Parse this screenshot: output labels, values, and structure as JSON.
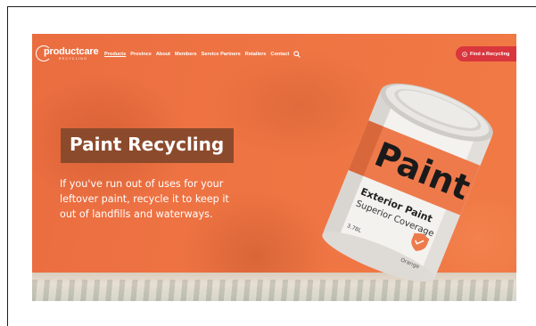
{
  "site": {
    "logo": {
      "main": "productcare",
      "sub": "RECYCLING"
    },
    "nav": {
      "items": [
        {
          "label": "Products",
          "active": true
        },
        {
          "label": "Province",
          "active": false
        },
        {
          "label": "About",
          "active": false
        },
        {
          "label": "Members",
          "active": false
        },
        {
          "label": "Service Partners",
          "active": false
        },
        {
          "label": "Retailers",
          "active": false
        },
        {
          "label": "Contact",
          "active": false
        }
      ],
      "search_icon": "search-icon"
    },
    "cta": {
      "label": "Find a Recycling",
      "icon": "location-pin-icon"
    },
    "hero": {
      "title": "Paint Recycling",
      "subtitle": "If you've run out of uses for your leftover paint, recycle it to keep it out of landfills and waterways."
    },
    "paint_can": {
      "label_big": "Paint",
      "label_line1": "Exterior Paint",
      "label_line2": "Superior Coverage",
      "volume": "3.78L",
      "color_name": "Orange"
    }
  },
  "colors": {
    "hero_orange": "#ef7443",
    "title_box": "#8c4a2c",
    "cta_red": "#d9363e",
    "can_band": "#ee7a4c"
  }
}
